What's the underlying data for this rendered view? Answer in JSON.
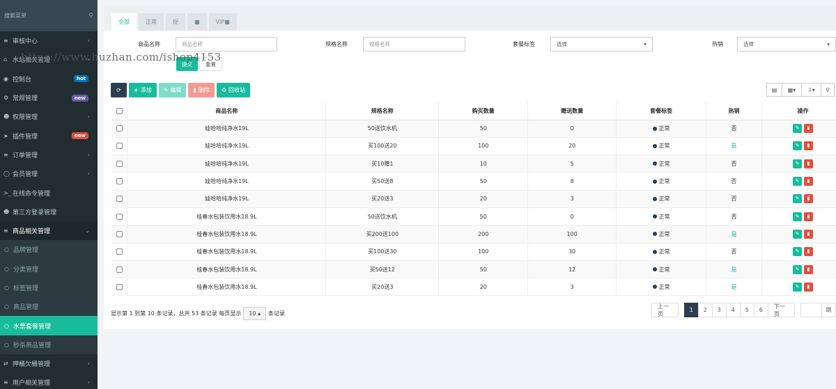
{
  "sidebar": {
    "search_placeholder": "搜索菜单",
    "items": [
      {
        "label": "审核中心",
        "icon": "list-icon",
        "glyph": "≡",
        "chev": "‹"
      },
      {
        "label": "水站相关管理",
        "icon": "home-icon",
        "glyph": "⌂",
        "chev": "‹"
      },
      {
        "label": "控制台",
        "icon": "dashboard-icon",
        "glyph": "◉",
        "badge": "hot",
        "badge_color": "#0073b7"
      },
      {
        "label": "常规管理",
        "icon": "cogs-icon",
        "glyph": "⚙",
        "badge": "new",
        "badge_color": "#605ca8"
      },
      {
        "label": "权限管理",
        "icon": "group-icon",
        "glyph": "☻",
        "chev": "‹"
      },
      {
        "label": "插件管理",
        "icon": "rocket-icon",
        "glyph": "➤",
        "badge": "new",
        "badge_color": "#dd4b39"
      },
      {
        "label": "订单管理",
        "icon": "list-icon",
        "glyph": "≡",
        "chev": "‹"
      },
      {
        "label": "会员管理",
        "icon": "user-circle-icon",
        "glyph": "◯",
        "chev": "‹"
      },
      {
        "label": "在线命令管理",
        "icon": "terminal-icon",
        "glyph": ">_"
      },
      {
        "label": "第三方登录管理",
        "icon": "users-icon",
        "glyph": "☻"
      },
      {
        "label": "商品相关管理",
        "icon": "list-icon",
        "glyph": "≡",
        "chev": "⌄",
        "open": true
      },
      {
        "label": "品牌管理",
        "icon": "circle-icon",
        "glyph": "○",
        "sub": true
      },
      {
        "label": "分类管理",
        "icon": "circle-icon",
        "glyph": "○",
        "sub": true
      },
      {
        "label": "标签管理",
        "icon": "circle-icon",
        "glyph": "○",
        "sub": true
      },
      {
        "label": "商品管理",
        "icon": "circle-icon",
        "glyph": "○",
        "sub": true
      },
      {
        "label": "水票套餐管理",
        "icon": "circle-icon",
        "glyph": "○",
        "sub": true,
        "active": true
      },
      {
        "label": "秒杀商品管理",
        "icon": "circle-icon",
        "glyph": "○",
        "sub": true
      },
      {
        "label": "押桶欠桶管理",
        "icon": "exchange-icon",
        "glyph": "⇄",
        "chev": "‹"
      },
      {
        "label": "用户相关管理",
        "icon": "list-icon",
        "glyph": "≡",
        "chev": "‹"
      }
    ]
  },
  "tabs": [
    "全部",
    "正常",
    "捉",
    "■",
    "VIP■"
  ],
  "filters": {
    "name_label": "商品名称",
    "name_placeholder": "商品名称",
    "spec_label": "规格名称",
    "spec_placeholder": "规格名称",
    "tag_label": "套餐标签",
    "tag_value": "选择",
    "hot_label": "热销",
    "hot_value": "选择",
    "submit": "提交",
    "reset": "重置"
  },
  "watermark": "https://www.huzhan.com/ishop4153",
  "toolbar": {
    "add": "添加",
    "edit": "编辑",
    "delete": "删除",
    "recycle": "回收站"
  },
  "table": {
    "headers": [
      "商品名称",
      "规格名称",
      "购买数量",
      "赠送数量",
      "套餐标签",
      "热销",
      "操作"
    ],
    "rows": [
      {
        "name": "娃哈哈纯净水19L",
        "spec": "50送饮水机",
        "buy": "50",
        "gift": "0",
        "tag": "正常",
        "hot": "否"
      },
      {
        "name": "娃哈哈纯净水19L",
        "spec": "买100送20",
        "buy": "100",
        "gift": "20",
        "tag": "正常",
        "hot": "是"
      },
      {
        "name": "娃哈哈纯净水19L",
        "spec": "买10赠1",
        "buy": "10",
        "gift": "5",
        "tag": "正常",
        "hot": "否"
      },
      {
        "name": "娃哈哈纯净水19L",
        "spec": "买50送8",
        "buy": "50",
        "gift": "8",
        "tag": "正常",
        "hot": "否"
      },
      {
        "name": "娃哈哈纯净水19L",
        "spec": "买20送3",
        "buy": "20",
        "gift": "3",
        "tag": "正常",
        "hot": "否"
      },
      {
        "name": "桂春水包装饮用水18.9L",
        "spec": "50送饮水机",
        "buy": "50",
        "gift": "0",
        "tag": "正常",
        "hot": "否"
      },
      {
        "name": "桂春水包装饮用水18.9L",
        "spec": "买200送100",
        "buy": "200",
        "gift": "100",
        "tag": "正常",
        "hot": "是"
      },
      {
        "name": "桂春水包装饮用水18.9L",
        "spec": "买100送30",
        "buy": "100",
        "gift": "30",
        "tag": "正常",
        "hot": "否"
      },
      {
        "name": "桂春水包装饮用水18.9L",
        "spec": "买50送12",
        "buy": "50",
        "gift": "12",
        "tag": "正常",
        "hot": "是"
      },
      {
        "name": "桂春水包装饮用水18.9L",
        "spec": "买20送3",
        "buy": "20",
        "gift": "3",
        "tag": "正常",
        "hot": "是"
      }
    ]
  },
  "footer": {
    "info_prefix": "显示第 1 到第 10 条记录，总共 53 条记录 每页显示",
    "page_size": "10",
    "info_suffix": "条记录"
  },
  "pagination": {
    "prev": "上一页",
    "pages": [
      "1",
      "2",
      "3",
      "4",
      "5",
      "6"
    ],
    "next": "下一页",
    "go": "跳"
  }
}
